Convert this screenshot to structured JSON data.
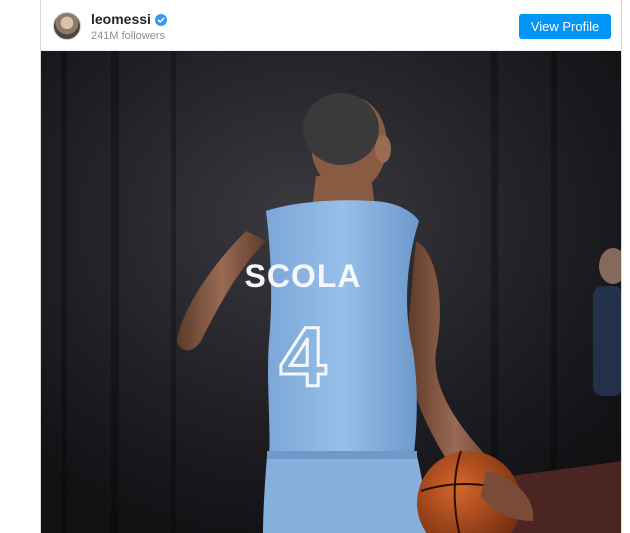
{
  "post": {
    "username": "leomessi",
    "followers": "241M followers",
    "view_profile_label": "View Profile",
    "verified": true
  },
  "photo": {
    "jersey_name": "SCOLA",
    "jersey_number": "4",
    "colors": {
      "jersey": "#8fb8e4",
      "background": "#1d1d21",
      "ball": "#c8551e"
    }
  },
  "icons": {
    "verified": "verified-badge-icon",
    "avatar": "avatar"
  }
}
